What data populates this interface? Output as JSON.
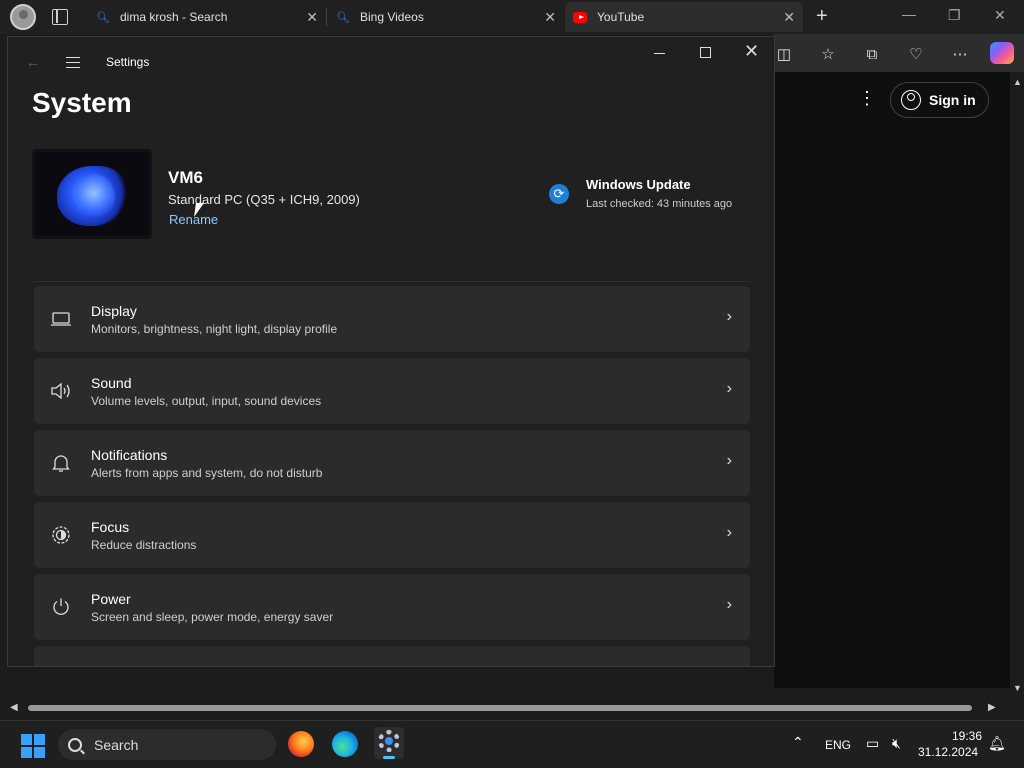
{
  "browser": {
    "tabs": [
      {
        "title": "dima krosh - Search",
        "favicon": "search-icon"
      },
      {
        "title": "Bing Videos",
        "favicon": "search-icon"
      },
      {
        "title": "YouTube",
        "favicon": "youtube-icon",
        "active": true
      }
    ],
    "youtube": {
      "sign_in_label": "Sign in"
    }
  },
  "settings": {
    "window_title": "Settings",
    "page_title": "System",
    "device": {
      "name": "VM6",
      "model": "Standard PC (Q35 + ICH9, 2009)",
      "rename_label": "Rename"
    },
    "windows_update": {
      "title": "Windows Update",
      "status": "Last checked: 43 minutes ago"
    },
    "items": [
      {
        "title": "Display",
        "subtitle": "Monitors, brightness, night light, display profile",
        "icon": "display-icon"
      },
      {
        "title": "Sound",
        "subtitle": "Volume levels, output, input, sound devices",
        "icon": "speaker-icon"
      },
      {
        "title": "Notifications",
        "subtitle": "Alerts from apps and system, do not disturb",
        "icon": "bell-icon"
      },
      {
        "title": "Focus",
        "subtitle": "Reduce distractions",
        "icon": "focus-icon"
      },
      {
        "title": "Power",
        "subtitle": "Screen and sleep, power mode, energy saver",
        "icon": "power-icon"
      }
    ]
  },
  "taskbar": {
    "search_label": "Search",
    "language": "ENG",
    "time": "19:36",
    "date": "31.12.2024"
  },
  "colors": {
    "accent": "#4cc2ff",
    "link": "#8ac8ff",
    "card_bg": "#2b2b2b",
    "window_bg": "#202020"
  }
}
